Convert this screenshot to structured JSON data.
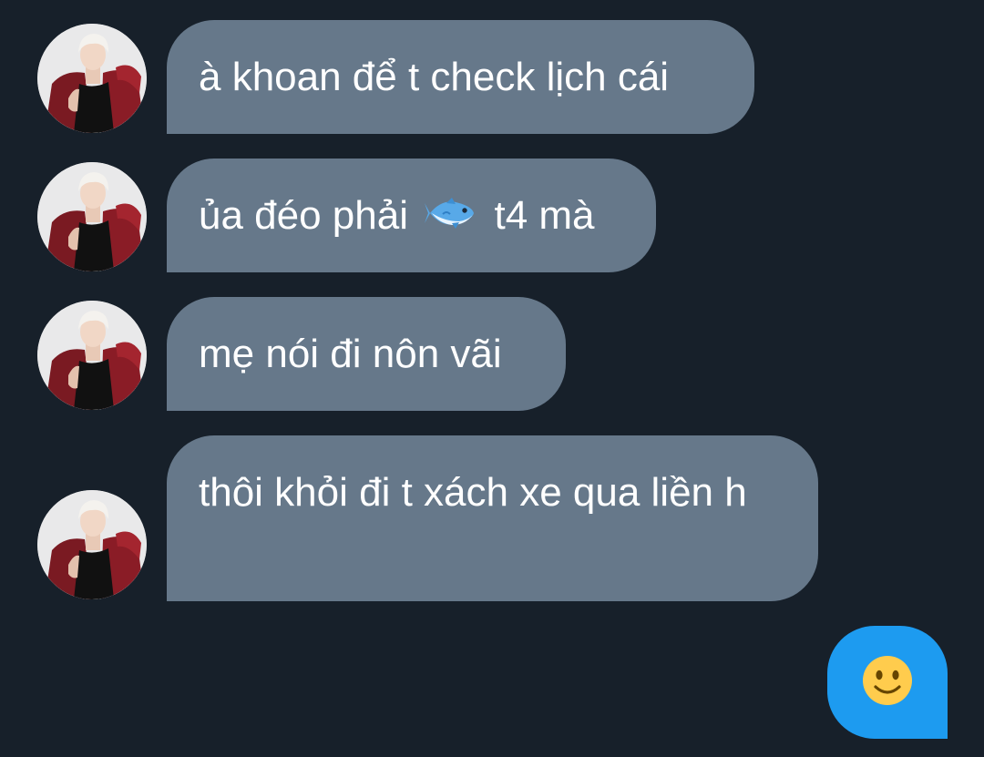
{
  "colors": {
    "background": "#17202a",
    "incoming_bubble": "#66788a",
    "outgoing_bubble": "#1d9bf0",
    "text": "#ffffff"
  },
  "conversation": {
    "messages": [
      {
        "direction": "incoming",
        "text": "à khoan để t check lịch cái"
      },
      {
        "direction": "incoming",
        "text_before": "ủa đéo phải",
        "emoji": "fish-icon",
        "text_after": "t4 mà"
      },
      {
        "direction": "incoming",
        "text": "mẹ nói đi nôn vãi"
      },
      {
        "direction": "incoming",
        "text": "thôi khỏi đi t xách xe qua liền h"
      },
      {
        "direction": "outgoing",
        "emoji": "slightly-smiling-face-icon"
      }
    ]
  }
}
